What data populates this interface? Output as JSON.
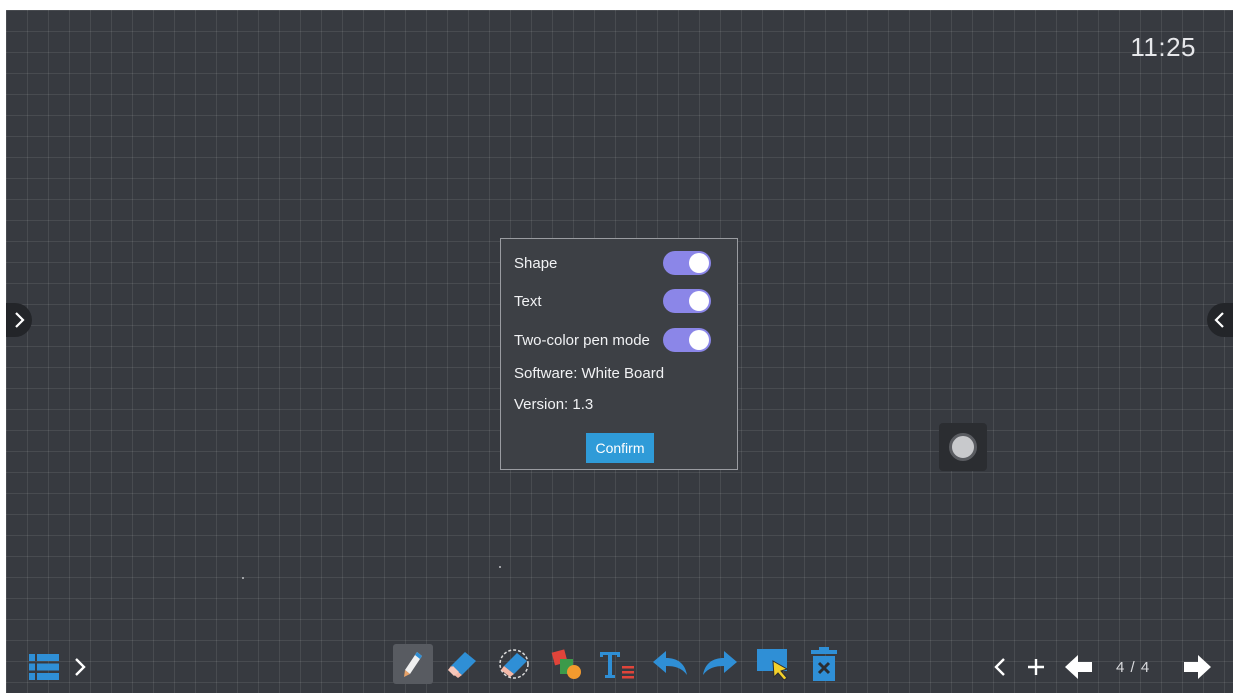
{
  "clock": {
    "time": "11:25"
  },
  "dialog": {
    "options": [
      {
        "label": "Shape",
        "enabled": true
      },
      {
        "label": "Text",
        "enabled": true
      },
      {
        "label": "Two-color pen mode",
        "enabled": true
      }
    ],
    "software": "Software: White Board",
    "version": "Version: 1.3",
    "confirm_label": "Confirm"
  },
  "pagination": {
    "label": "4 / 4"
  },
  "toolbar": {
    "tools": [
      "pen-icon",
      "eraser-icon",
      "area-eraser-icon",
      "shapes-icon",
      "text-icon",
      "undo-icon",
      "redo-icon",
      "select-icon",
      "clear-icon"
    ],
    "active_tool": "pen-icon"
  },
  "colors": {
    "board": "#373a40",
    "toggle_on": "#8b86e8",
    "confirm": "#2f9bd8",
    "accent_blue": "#2f8fd6"
  }
}
